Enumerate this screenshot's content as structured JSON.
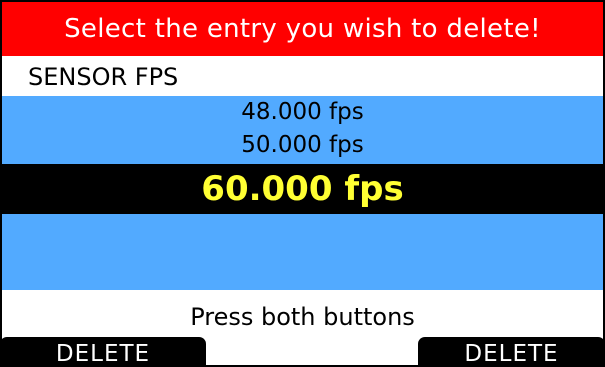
{
  "header": {
    "title": "Select the entry you wish to delete!",
    "background": "#ff0000"
  },
  "list": {
    "title": "SENSOR FPS",
    "background": "#52aaff",
    "options": [
      {
        "label": "48.000 fps",
        "selected": false
      },
      {
        "label": "50.000 fps",
        "selected": false
      },
      {
        "label": "60.000 fps",
        "selected": true
      }
    ],
    "selected_text_color": "#ffff33"
  },
  "instruction": "Press both buttons",
  "buttons": {
    "left_label": "DELETE",
    "right_label": "DELETE"
  }
}
